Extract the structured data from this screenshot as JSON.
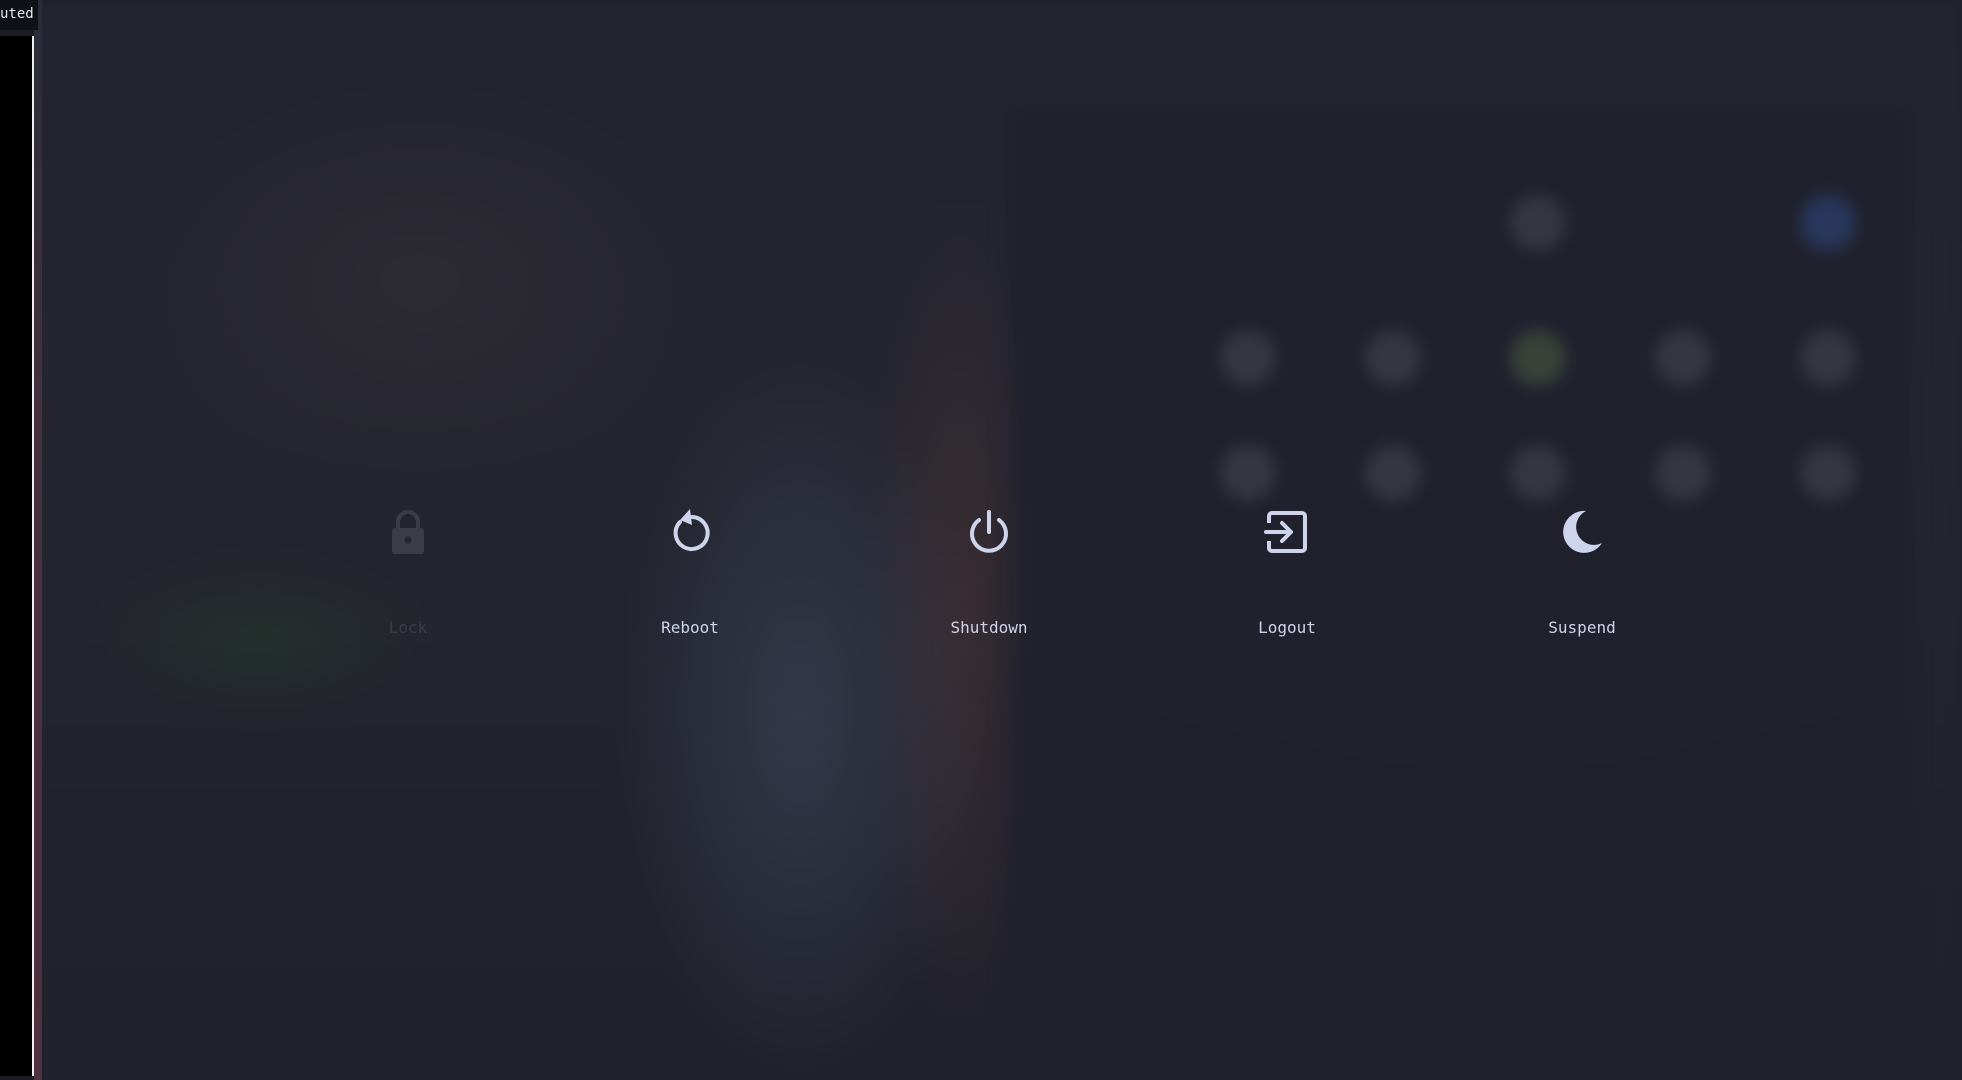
{
  "terminal": {
    "title": "uted"
  },
  "power_menu": {
    "options": [
      {
        "label": "Lock",
        "icon": "lock-icon",
        "selected": false
      },
      {
        "label": "Reboot",
        "icon": "reboot-icon",
        "selected": false
      },
      {
        "label": "Shutdown",
        "icon": "power-icon",
        "selected": false
      },
      {
        "label": "Logout",
        "icon": "logout-icon",
        "selected": false
      },
      {
        "label": "Suspend",
        "icon": "moon-icon",
        "selected": false
      }
    ]
  },
  "colors": {
    "icon": "#cdd4ec",
    "dimmed": "#3a3c48",
    "background": "#23252f"
  }
}
